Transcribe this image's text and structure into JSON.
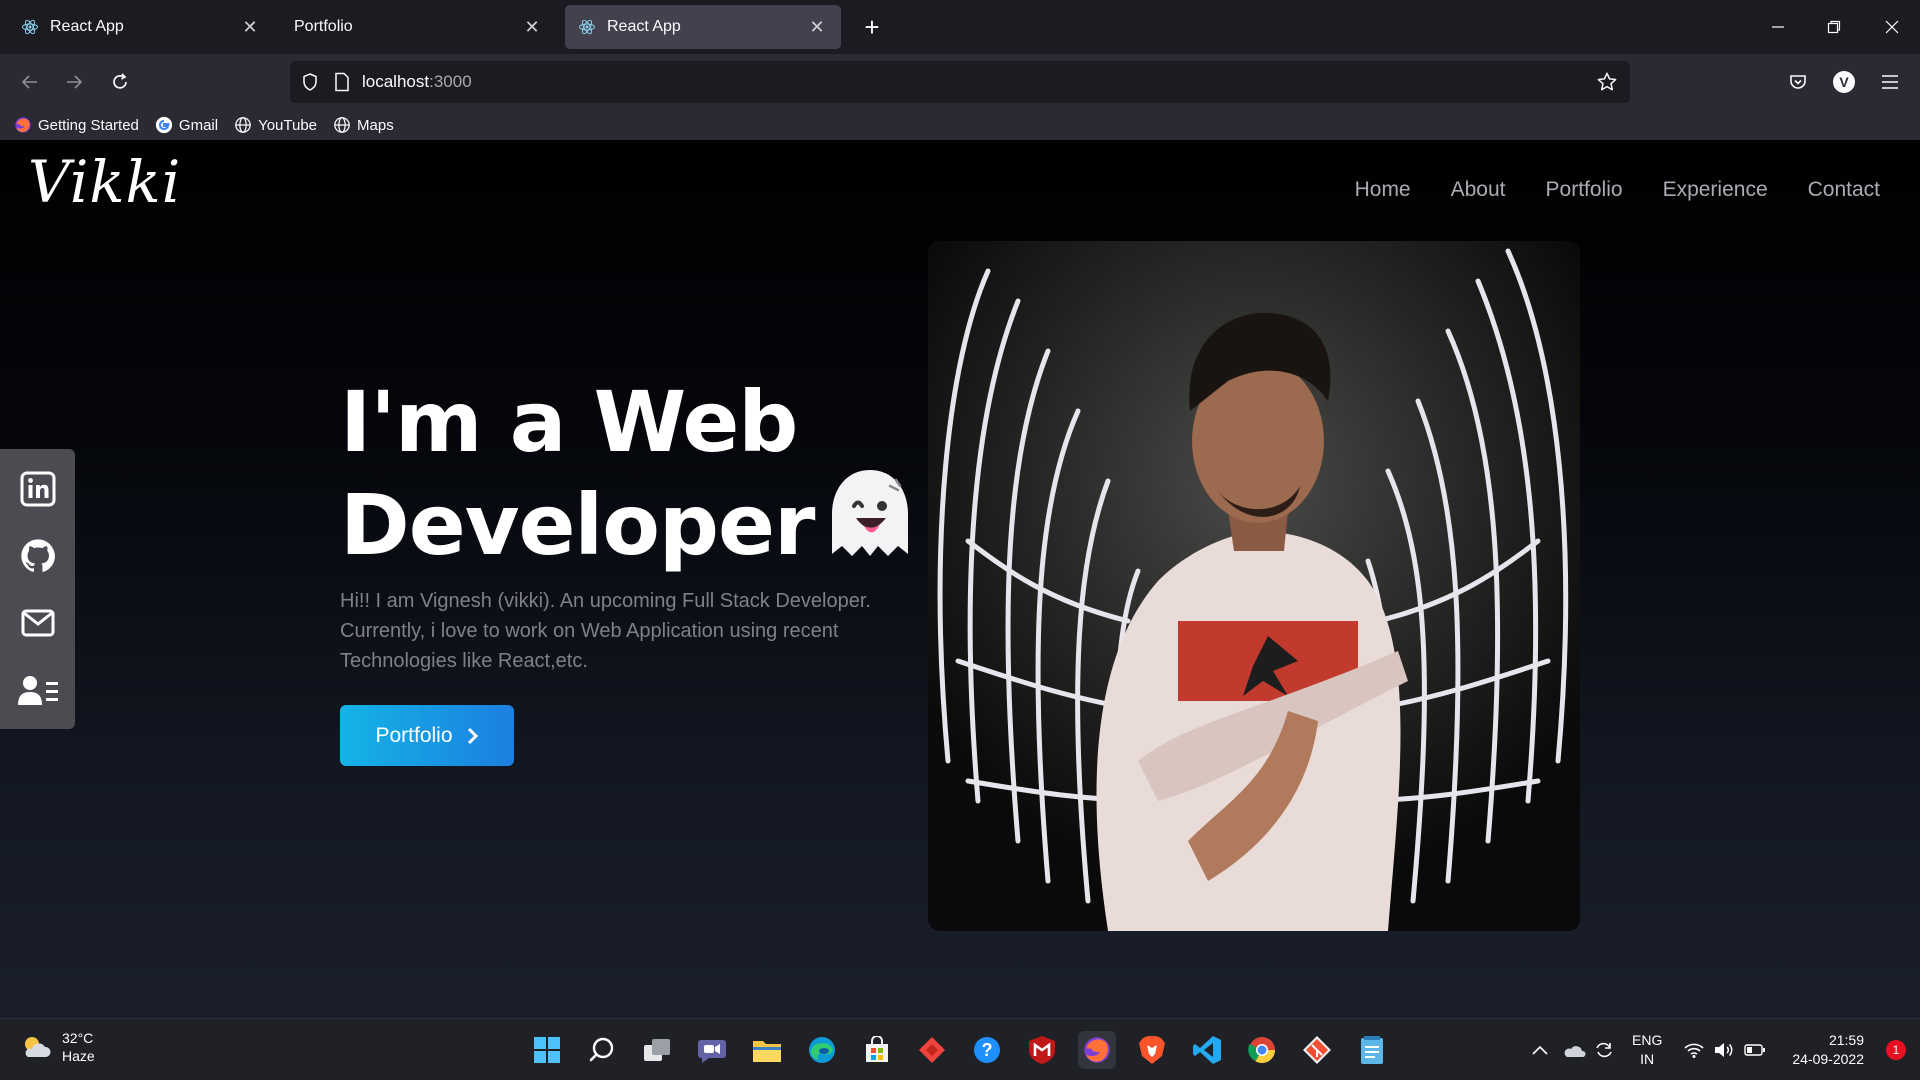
{
  "browser": {
    "tabs": [
      {
        "title": "React App",
        "icon": "react-icon"
      },
      {
        "title": "Portfolio",
        "icon": ""
      },
      {
        "title": "React App",
        "icon": "react-icon",
        "active": true
      }
    ],
    "new_tab": "+",
    "url_host": "localhost",
    "url_port": ":3000",
    "bookmarks": [
      {
        "label": "Getting Started",
        "icon": "firefox-icon"
      },
      {
        "label": "Gmail",
        "icon": "google-icon"
      },
      {
        "label": "YouTube",
        "icon": "globe-icon"
      },
      {
        "label": "Maps",
        "icon": "globe-icon"
      }
    ],
    "account_initial": "V"
  },
  "site": {
    "logo": "Vikki",
    "nav": [
      "Home",
      "About",
      "Portfolio",
      "Experience",
      "Contact"
    ],
    "social": [
      "linkedin-icon",
      "github-icon",
      "mail-icon",
      "contact-card-icon"
    ],
    "hero": {
      "title_line1": "I'm a Web",
      "title_line2": "Developer",
      "description": "Hi!! I am Vignesh (vikki). An upcoming Full Stack Developer. Currently, i love to work on Web Application using recent Technologies like React,etc.",
      "cta_label": "Portfolio"
    },
    "colors": {
      "accent_start": "#15b3e6",
      "accent_end": "#1b7fe0",
      "nav_text": "#a9acb3"
    }
  },
  "taskbar": {
    "weather_temp": "32°C",
    "weather_desc": "Haze",
    "apps": [
      "windows-start-icon",
      "search-icon",
      "task-view-icon",
      "chat-icon",
      "file-explorer-icon",
      "edge-icon",
      "store-icon",
      "anydesk-icon",
      "help-icon",
      "mcafee-icon",
      "firefox-icon",
      "brave-icon",
      "vscode-icon",
      "chrome-icon",
      "git-icon",
      "notepad-icon"
    ],
    "language_top": "ENG",
    "language_bottom": "IN",
    "time": "21:59",
    "date": "24-09-2022",
    "notifications": "1"
  }
}
